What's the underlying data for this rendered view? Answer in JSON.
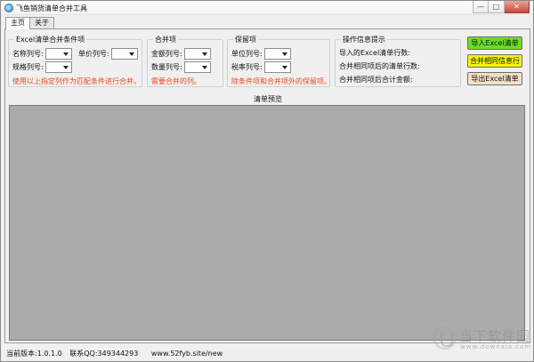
{
  "window": {
    "title": "飞鱼销货清单合并工具",
    "minimize": "—",
    "maximize": "□",
    "close": "✕"
  },
  "tabs": [
    {
      "label": "主页"
    },
    {
      "label": "关于"
    }
  ],
  "merge_conditions": {
    "title": "Excel清单合并条件项",
    "name_col_label": "名称列号:",
    "unit_price_col_label": "单价列号:",
    "spec_col_label": "规格列号:",
    "hint": "使用以上指定列作为匹配条件进行合并。"
  },
  "merge_items": {
    "title": "合并项",
    "amount_col_label": "金额列号:",
    "quantity_col_label": "数量列号:",
    "hint": "需要合并的列。"
  },
  "keep_items": {
    "title": "保留项",
    "unit_col_label": "单位列号:",
    "tax_rate_col_label": "税率列号:",
    "hint": "除条件项和合并项外的保留项。"
  },
  "op_info": {
    "title": "操作信息提示",
    "line1": "导入的Excel清单行数:",
    "line2": "合并相同项后的清单行数:",
    "line3": "合并相同项后合计金额:"
  },
  "actions": {
    "import_label": "导入Excel清单",
    "merge_label": "合并相同信息行",
    "export_label": "导出Excel清单",
    "import_color": "#6bdc2a",
    "merge_color": "#f4f40a",
    "export_color": "#f5dfc8"
  },
  "preview": {
    "title": "清单预览"
  },
  "status": {
    "version": "当前版本:1.0.1.0",
    "contact": "联系QQ:349344293",
    "site": "www.52fyb.site/new"
  },
  "watermark": {
    "text": "当下软件园",
    "url": "www.downxia.com"
  }
}
